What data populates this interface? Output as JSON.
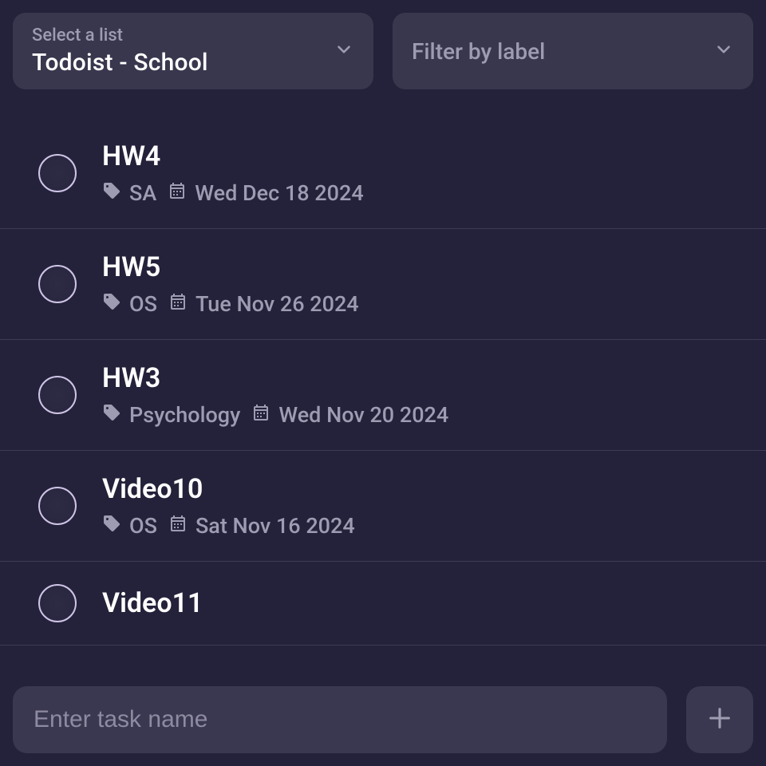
{
  "selectors": {
    "list": {
      "label": "Select a list",
      "value": "Todoist - School"
    },
    "label_filter": {
      "placeholder": "Filter by label"
    }
  },
  "tasks": [
    {
      "title": "HW4",
      "tag": "SA",
      "date": "Wed Dec 18 2024"
    },
    {
      "title": "HW5",
      "tag": "OS",
      "date": "Tue Nov 26 2024"
    },
    {
      "title": "HW3",
      "tag": "Psychology",
      "date": "Wed Nov 20 2024"
    },
    {
      "title": "Video10",
      "tag": "OS",
      "date": "Sat Nov 16 2024"
    },
    {
      "title": "Video11"
    }
  ],
  "input": {
    "placeholder": "Enter task name"
  }
}
